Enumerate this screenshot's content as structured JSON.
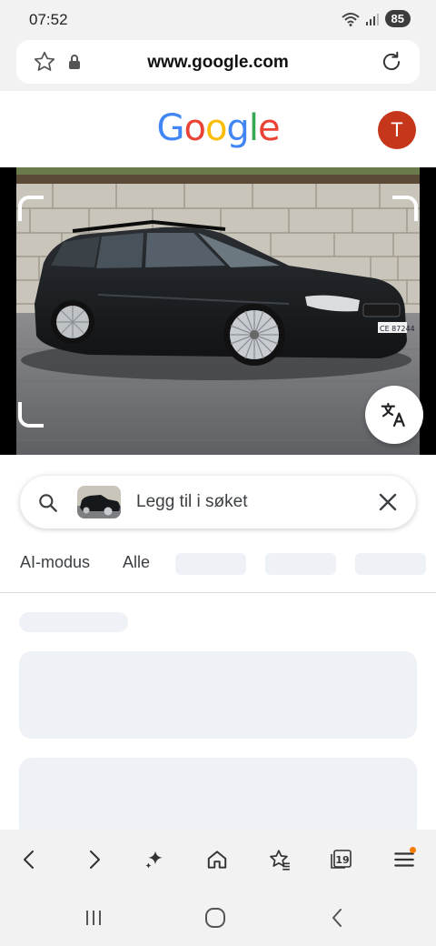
{
  "status": {
    "time": "07:52",
    "battery": "85"
  },
  "browser": {
    "url": "www.google.com"
  },
  "header": {
    "logo_letters": [
      {
        "ch": "G",
        "color": "#4285F4"
      },
      {
        "ch": "o",
        "color": "#EA4335"
      },
      {
        "ch": "o",
        "color": "#FBBC05"
      },
      {
        "ch": "g",
        "color": "#4285F4"
      },
      {
        "ch": "l",
        "color": "#34A853"
      },
      {
        "ch": "e",
        "color": "#EA4335"
      }
    ],
    "avatar_initial": "T",
    "avatar_color": "#c5361a"
  },
  "image": {
    "plate_text": "CE 87244"
  },
  "search": {
    "placeholder": "Legg til i søket"
  },
  "tabs": {
    "ai_mode": "AI-modus",
    "all": "Alle"
  },
  "toolbar": {
    "tab_count": "19"
  },
  "icons": [
    "star-icon",
    "lock-icon",
    "reload-icon",
    "translate-icon",
    "search-icon",
    "close-icon",
    "back-icon",
    "forward-icon",
    "ai-sparkle-icon",
    "home-icon",
    "bookmarks-icon",
    "tabs-icon",
    "menu-icon",
    "recents-icon",
    "home-circle-icon",
    "system-back-icon"
  ]
}
